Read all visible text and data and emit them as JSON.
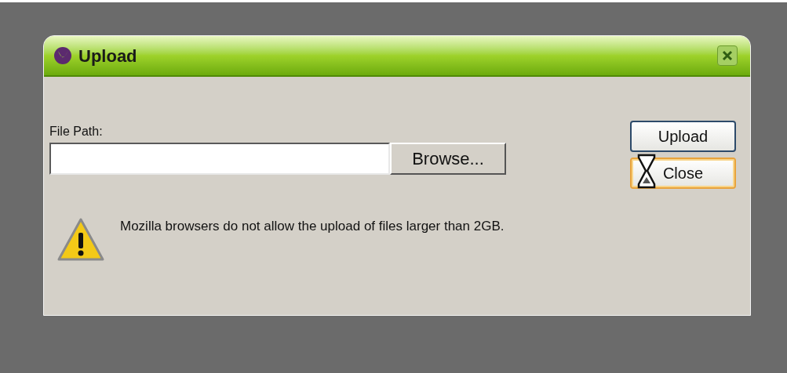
{
  "dialog": {
    "title": "Upload"
  },
  "file_path": {
    "label": "File Path:",
    "browse_button": "Browse..."
  },
  "message": "Mozilla browsers do not allow the upload of files larger than 2GB.",
  "buttons": [
    {
      "label": "Upload",
      "focused": false
    },
    {
      "label": "Close",
      "focused": true
    }
  ]
}
